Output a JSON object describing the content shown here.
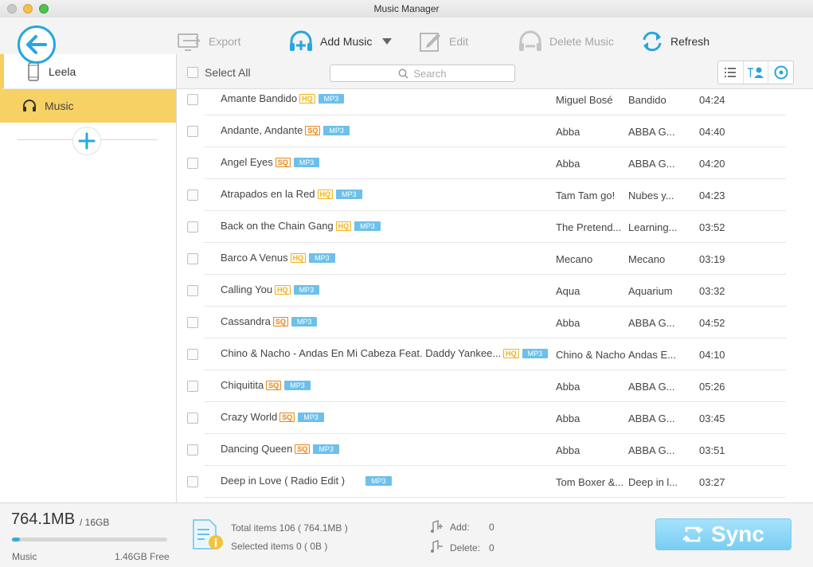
{
  "window": {
    "title": "Music Manager"
  },
  "toolbar": {
    "export_label": "Export",
    "add_music_label": "Add Music",
    "edit_label": "Edit",
    "delete_label": "Delete Music",
    "refresh_label": "Refresh"
  },
  "sidebar": {
    "device_name": "Leela",
    "music_label": "Music"
  },
  "list": {
    "select_all_label": "Select All",
    "search_placeholder": "Search",
    "rows": [
      {
        "title": "Amante Bandido",
        "quality": "HQ",
        "format": "MP3",
        "artist": "Miguel Bosé",
        "album": "Bandido",
        "time": "04:24"
      },
      {
        "title": "Andante, Andante",
        "quality": "SQ",
        "format": "MP3",
        "artist": "Abba",
        "album": "ABBA G...",
        "time": "04:40"
      },
      {
        "title": "Angel Eyes",
        "quality": "SQ",
        "format": "MP3",
        "artist": "Abba",
        "album": "ABBA G...",
        "time": "04:20"
      },
      {
        "title": "Atrapados en la Red",
        "quality": "HQ",
        "format": "MP3",
        "artist": "Tam Tam go!",
        "album": "Nubes y...",
        "time": "04:23"
      },
      {
        "title": "Back on the Chain Gang",
        "quality": "HQ",
        "format": "MP3",
        "artist": "The Pretend...",
        "album": "Learning...",
        "time": "03:52"
      },
      {
        "title": "Barco A Venus",
        "quality": "HQ",
        "format": "MP3",
        "artist": "Mecano",
        "album": "Mecano",
        "time": "03:19"
      },
      {
        "title": "Calling You",
        "quality": "HQ",
        "format": "MP3",
        "artist": "Aqua",
        "album": "Aquarium",
        "time": "03:32"
      },
      {
        "title": "Cassandra",
        "quality": "SQ",
        "format": "MP3",
        "artist": "Abba",
        "album": "ABBA G...",
        "time": "04:52"
      },
      {
        "title": "Chino & Nacho - Andas En Mi Cabeza Feat. Daddy Yankee...",
        "quality": "HQ",
        "format": "MP3",
        "artist": "Chino & Nacho",
        "album": "Andas E...",
        "time": "04:10"
      },
      {
        "title": "Chiquitita",
        "quality": "SQ",
        "format": "MP3",
        "artist": "Abba",
        "album": "ABBA G...",
        "time": "05:26"
      },
      {
        "title": "Crazy World",
        "quality": "SQ",
        "format": "MP3",
        "artist": "Abba",
        "album": "ABBA G...",
        "time": "03:45"
      },
      {
        "title": "Dancing Queen",
        "quality": "SQ",
        "format": "MP3",
        "artist": "Abba",
        "album": "ABBA G...",
        "time": "03:51"
      },
      {
        "title": "Deep in Love ( Radio Edit )",
        "quality": "",
        "format": "MP3",
        "artist": "Tom Boxer &...",
        "album": "Deep in l...",
        "time": "03:27"
      }
    ]
  },
  "storage": {
    "used": "764.1MB",
    "total": "/ 16GB",
    "category": "Music",
    "free": "1.46GB Free",
    "used_fraction": 0.05
  },
  "summary": {
    "total_items": "Total items 106 ( 764.1MB )",
    "selected_items": "Selected items 0 ( 0B )",
    "add_label": "Add:",
    "add_value": "0",
    "delete_label": "Delete:",
    "delete_value": "0"
  },
  "sync": {
    "label": "Sync"
  },
  "colors": {
    "accent": "#27a6e0",
    "selected_nav": "#f7d163",
    "hq": "#f0b51e",
    "sq": "#e98b22",
    "mp3": "#6cc0ea"
  }
}
